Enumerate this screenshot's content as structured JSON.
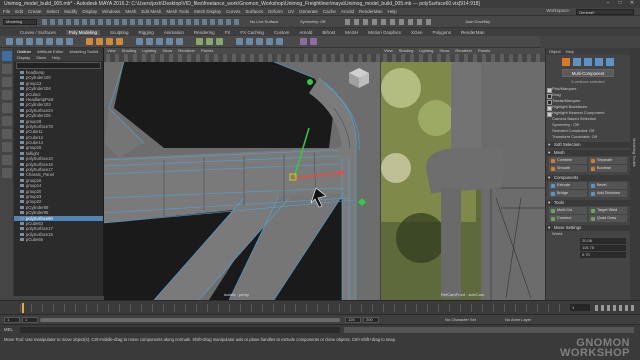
{
  "window": {
    "title": "Unimog_model_build_005.mb* - Autodesk MAYA 2016.2: C:\\Users\\josh\\Desktop\\VID_files\\freelance_work\\Gnomon_Workshop\\Unimog_Freightliner\\maya\\Unimog_model_build_005.mb  ---  polySurface60.vtx[914:918]"
  },
  "menubar": {
    "items": [
      "File",
      "Edit",
      "Create",
      "Select",
      "Modify",
      "Display",
      "Windows",
      "Mesh",
      "Edit Mesh",
      "Mesh Tools",
      "Mesh Display",
      "Curves",
      "Surfaces",
      "Deform",
      "UV",
      "Generate",
      "Cache",
      "Arnold",
      "RenderMan",
      "Help"
    ],
    "workspace_label": "Workspace:",
    "workspace_value": "General*"
  },
  "statusline": {
    "mode": "Modeling",
    "live_surface": "No Live Surface",
    "symmetry": "Symmetry: Off",
    "user": "Josh Doveflay"
  },
  "shelf": {
    "tabs": [
      "Curves / Surfaces",
      "Poly Modeling",
      "Sculpting",
      "Rigging",
      "Animation",
      "Rendering",
      "FX",
      "FX Caching",
      "Custom",
      "Arnold",
      "Bifrost",
      "MASH",
      "Motion Graphics",
      "XGen",
      "Polygons",
      "RenderMan",
      "Poly Modeling"
    ],
    "active": "Poly Modeling"
  },
  "outliner": {
    "tabs": [
      "Outliner",
      "Attribute Editor",
      "Modeling Toolkit"
    ],
    "menu": [
      "Display",
      "Show",
      "Help"
    ],
    "search_placeholder": "",
    "items": [
      "headlamp",
      "pCylinder100",
      "group13",
      "pCylinder104",
      "pCube2",
      "HeadlampPost",
      "pCylinder103",
      "polySurface24",
      "pCylinder105",
      "group18",
      "polySurface78",
      "pCube11",
      "pCube12",
      "pCube14",
      "group15",
      "taillight",
      "polySurface10",
      "polySurface16",
      "polySurface17",
      "Chassis_Panel",
      "group16",
      "group14",
      "group20",
      "group23",
      "group22",
      "pCylinder89",
      "pCylinder95",
      "polySurface60",
      "pCube53",
      "polySurface17",
      "polySurface15",
      "pCube55"
    ],
    "selected_index": 27
  },
  "viewport_left": {
    "menu": [
      "View",
      "Shading",
      "Lighting",
      "Show",
      "Renderer",
      "Panels"
    ],
    "camera": "isolate : persp"
  },
  "viewport_right": {
    "menu": [
      "View",
      "Shading",
      "Lighting",
      "Show",
      "Renderer",
      "Panels"
    ],
    "camera": "RefCamFront : sideCam"
  },
  "modeling_toolkit": {
    "header": [
      "Object",
      "Help"
    ],
    "multi_component": "Multi-Component",
    "selection_info": "5 vertices selected",
    "pick_options": [
      "Pick/Marquee",
      "Drag",
      "Tweak/Marquee",
      "Highlight Backfaces",
      "Highlight Nearest Component"
    ],
    "pick_on": [
      true,
      false,
      false,
      true,
      true
    ],
    "camera_based": "Camera Based Selection",
    "symmetry": "Symmetry :",
    "symmetry_value": "Off",
    "selected_constraint": "Selected Constraint:",
    "selected_constraint_value": "Off",
    "transform_constraint": "Transform Constraint:",
    "transform_constraint_value": "Off",
    "soft_selection": "Soft Selection",
    "mesh_section": "Mesh",
    "mesh_buttons": [
      "Combine",
      "Separate",
      "Smooth",
      "Boolean"
    ],
    "components_section": "Components",
    "component_buttons": [
      "Extrude",
      "Bevel",
      "Bridge",
      "Add Divisions"
    ],
    "tools_section": "Tools",
    "tool_buttons": [
      "Multi-Cut",
      "Target Weld",
      "Connect",
      "Quad Draw"
    ],
    "move_settings": "Move Settings",
    "world_label": "World",
    "values": [
      "20.06",
      "115.75",
      "0.70"
    ]
  },
  "side_tab": "Modeling Toolkit",
  "timeline": {
    "start": "1",
    "end": "120",
    "range_end": "200",
    "current": "1",
    "character_set": "No Character Set",
    "anim_layer": "No Anim Layer"
  },
  "command_line": {
    "label": "MEL"
  },
  "help_line": "Move Tool: Use manipulator to move object(s). Ctrl+middle-drag to move components along normals. Shift+drag manipulator axis or plane handles to extrude components or clone objects. Ctrl+Shift+drag to snap.",
  "watermark": [
    "GNOMON",
    "WORKSHOP"
  ]
}
